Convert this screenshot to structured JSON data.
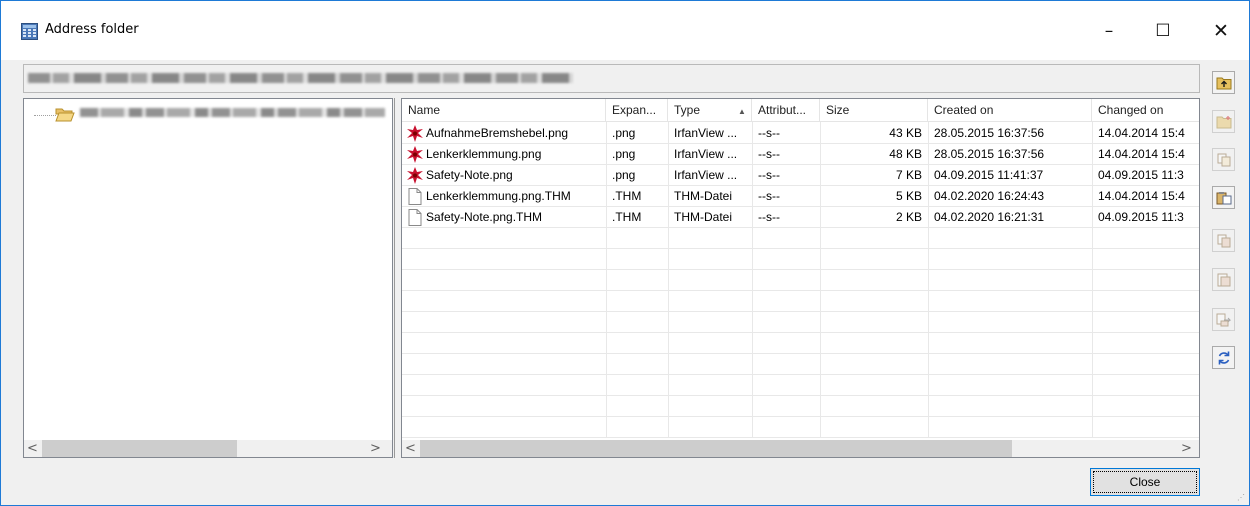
{
  "window": {
    "title": "Address folder",
    "title_icon": "app-grid-icon",
    "controls": {
      "minimize": "–",
      "maximize": "☐",
      "close": "✕"
    }
  },
  "tree": {
    "root_icon": "open-folder-icon"
  },
  "list": {
    "columns": [
      {
        "label": "Name"
      },
      {
        "label": "Expan..."
      },
      {
        "label": "Type",
        "sorted": "ascending"
      },
      {
        "label": "Attribut..."
      },
      {
        "label": "Size"
      },
      {
        "label": "Created on"
      },
      {
        "label": "Changed on"
      }
    ],
    "rows": [
      {
        "icon": "irfanview-image-icon",
        "name": "AufnahmeBremshebel.png",
        "ext": ".png",
        "type": "IrfanView ...",
        "attr": "--s--",
        "size": "43 KB",
        "created": "28.05.2015  16:37:56",
        "changed": "14.04.2014  15:4"
      },
      {
        "icon": "irfanview-image-icon",
        "name": "Lenkerklemmung.png",
        "ext": ".png",
        "type": "IrfanView ...",
        "attr": "--s--",
        "size": "48 KB",
        "created": "28.05.2015  16:37:56",
        "changed": "14.04.2014  15:4"
      },
      {
        "icon": "irfanview-image-icon",
        "name": "Safety-Note.png",
        "ext": ".png",
        "type": "IrfanView ...",
        "attr": "--s--",
        "size": "7 KB",
        "created": "04.09.2015  11:41:37",
        "changed": "04.09.2015  11:3"
      },
      {
        "icon": "blank-file-icon",
        "name": "Lenkerklemmung.png.THM",
        "ext": ".THM",
        "type": "THM-Datei",
        "attr": "--s--",
        "size": "5 KB",
        "created": "04.02.2020  16:24:43",
        "changed": "14.04.2014  15:4"
      },
      {
        "icon": "blank-file-icon",
        "name": "Safety-Note.png.THM",
        "ext": ".THM",
        "type": "THM-Datei",
        "attr": "--s--",
        "size": "2 KB",
        "created": "04.02.2020  16:21:31",
        "changed": "04.09.2015  11:3"
      }
    ]
  },
  "scrollbars": {
    "left_arrow": "<",
    "right_arrow": ">"
  },
  "sidebar_buttons": [
    {
      "icon": "folder-up-icon",
      "enabled": true
    },
    {
      "icon": "new-folder-icon",
      "enabled": false
    },
    {
      "icon": "copy-file-icon",
      "enabled": false
    },
    {
      "icon": "paste-file-icon",
      "enabled": true
    },
    {
      "icon": "move-file-icon",
      "enabled": false
    },
    {
      "icon": "delete-file-icon",
      "enabled": false
    },
    {
      "icon": "rename-file-icon",
      "enabled": false
    },
    {
      "icon": "refresh-icon",
      "enabled": true
    }
  ],
  "footer": {
    "close_label": "Close"
  },
  "colors": {
    "accent": "#0078d7",
    "icon_red": "#c8102e"
  }
}
